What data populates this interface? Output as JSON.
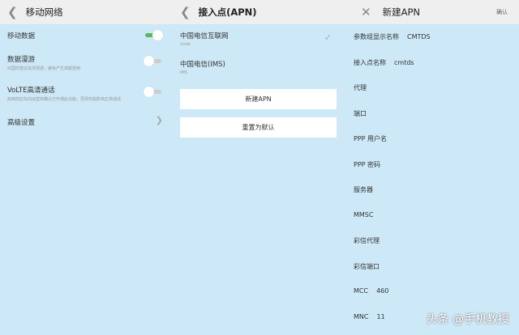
{
  "left": {
    "title": "移动网络",
    "items": [
      {
        "label": "移动数据",
        "on": true
      },
      {
        "label": "数据漫游",
        "sub": "出国时建议关闭漫游，避免产生高额费用",
        "on": false
      },
      {
        "label": "VoLTE高清通话",
        "sub": "启用前应先向运营商确认已开通此功能，否则可能影响正常通话",
        "on": false
      }
    ],
    "advanced": "高级设置"
  },
  "middle": {
    "title": "接入点(APN)",
    "apns": [
      {
        "name": "中国电信互联网",
        "sub": "ctnet",
        "selected": true
      },
      {
        "name": "中国电信(IMS)",
        "sub": "IMS"
      }
    ],
    "new_button": "新建APN",
    "reset_button": "重置为默认"
  },
  "right": {
    "title": "新建APN",
    "confirm": "确认",
    "fields": [
      {
        "label": "参数组显示名称",
        "value": "CMTDS"
      },
      {
        "label": "接入点名称",
        "value": "cmtds"
      },
      {
        "label": "代理"
      },
      {
        "label": "端口"
      },
      {
        "label": "PPP 用户名"
      },
      {
        "label": "PPP 密码"
      },
      {
        "label": "服务器"
      },
      {
        "label": "MMSC"
      },
      {
        "label": "彩信代理"
      },
      {
        "label": "彩信端口"
      },
      {
        "label": "MCC",
        "value": "460"
      },
      {
        "label": "MNC",
        "value": "11"
      }
    ]
  },
  "watermark": "头条 @手机教授"
}
